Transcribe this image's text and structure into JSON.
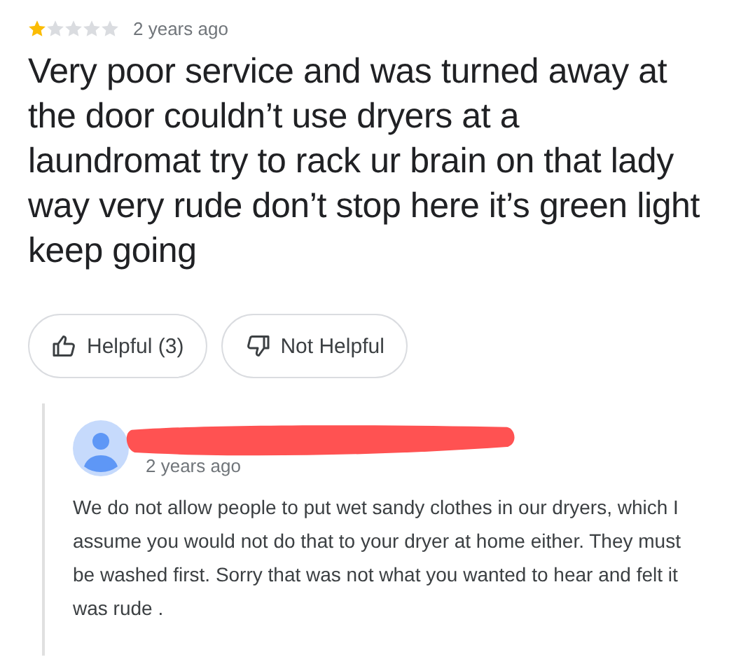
{
  "review": {
    "stars": 1,
    "time": "2 years ago",
    "text": "Very poor service and was turned away at the door couldn’t use dryers at a laundromat try to rack ur brain on that lady way very rude don’t stop here it’s green light keep going"
  },
  "buttons": [
    {
      "kind": "up",
      "label": "Helpful (3)"
    },
    {
      "kind": "down",
      "label": "Not Helpful"
    }
  ],
  "owner_reply": {
    "name_redacted": true,
    "time": "2 years ago",
    "text": "We do not allow people to put wet sandy clothes in our dryers, which I assume you would not do that to your dryer at home either. They must be washed first.   Sorry that was not what you wanted to hear and felt it was rude ."
  }
}
